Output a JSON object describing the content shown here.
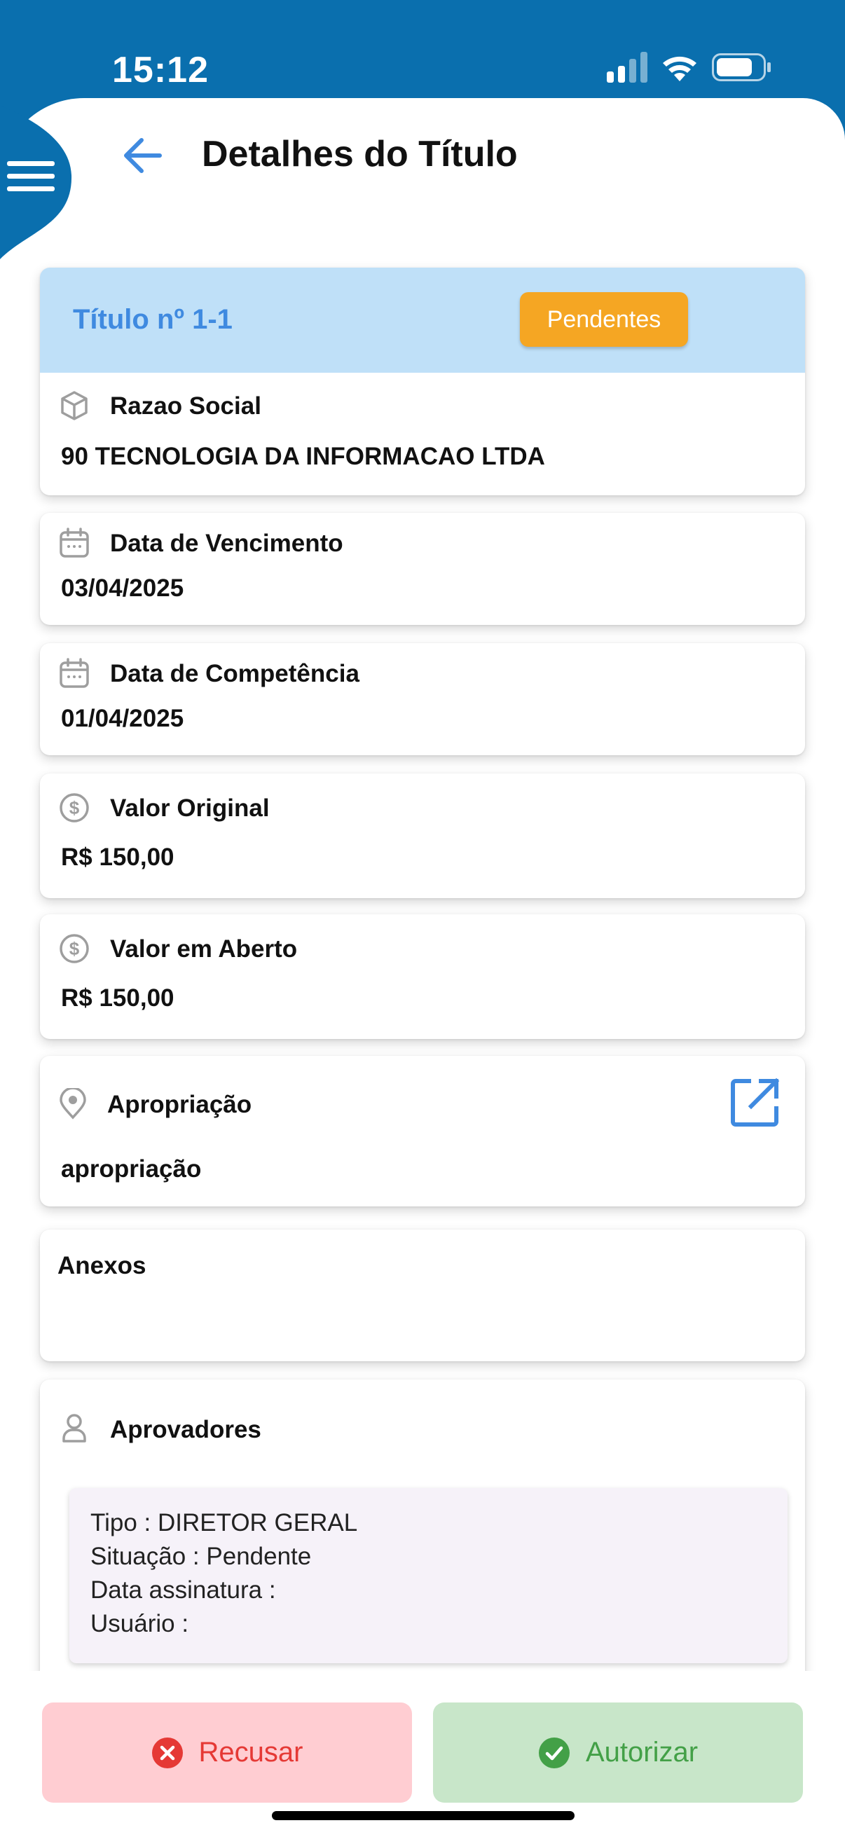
{
  "status_bar": {
    "time": "15:12"
  },
  "header": {
    "title": "Detalhes do Título"
  },
  "titulo": {
    "label": "Título nº 1-1",
    "status": "Pendentes"
  },
  "fields": {
    "razao_social": {
      "label": "Razao Social",
      "value": "90 TECNOLOGIA DA INFORMACAO LTDA"
    },
    "data_vencimento": {
      "label": "Data de Vencimento",
      "value": "03/04/2025"
    },
    "data_competencia": {
      "label": "Data de Competência",
      "value": "01/04/2025"
    },
    "valor_original": {
      "label": "Valor Original",
      "value": "R$ 150,00"
    },
    "valor_aberto": {
      "label": "Valor em Aberto",
      "value": "R$ 150,00"
    },
    "apropriacao": {
      "label": "Apropriação",
      "value": "apropriação"
    }
  },
  "anexos": {
    "label": "Anexos"
  },
  "aprovadores": {
    "label": "Aprovadores",
    "items": [
      {
        "tipo": "Tipo : DIRETOR GERAL",
        "situacao": "Situação : Pendente",
        "data_assinatura": "Data assinatura :",
        "usuario": "Usuário :"
      }
    ]
  },
  "actions": {
    "reject_label": "Recusar",
    "approve_label": "Autorizar"
  },
  "colors": {
    "brand_blue": "#0a6fae",
    "accent_blue": "#3f8ae0",
    "header_bg": "#bfe0f8",
    "badge_orange": "#f5a623",
    "reject_bg": "#ffcdd2",
    "reject_fg": "#e53935",
    "approve_bg": "#c8e6c9",
    "approve_fg": "#43a047"
  }
}
